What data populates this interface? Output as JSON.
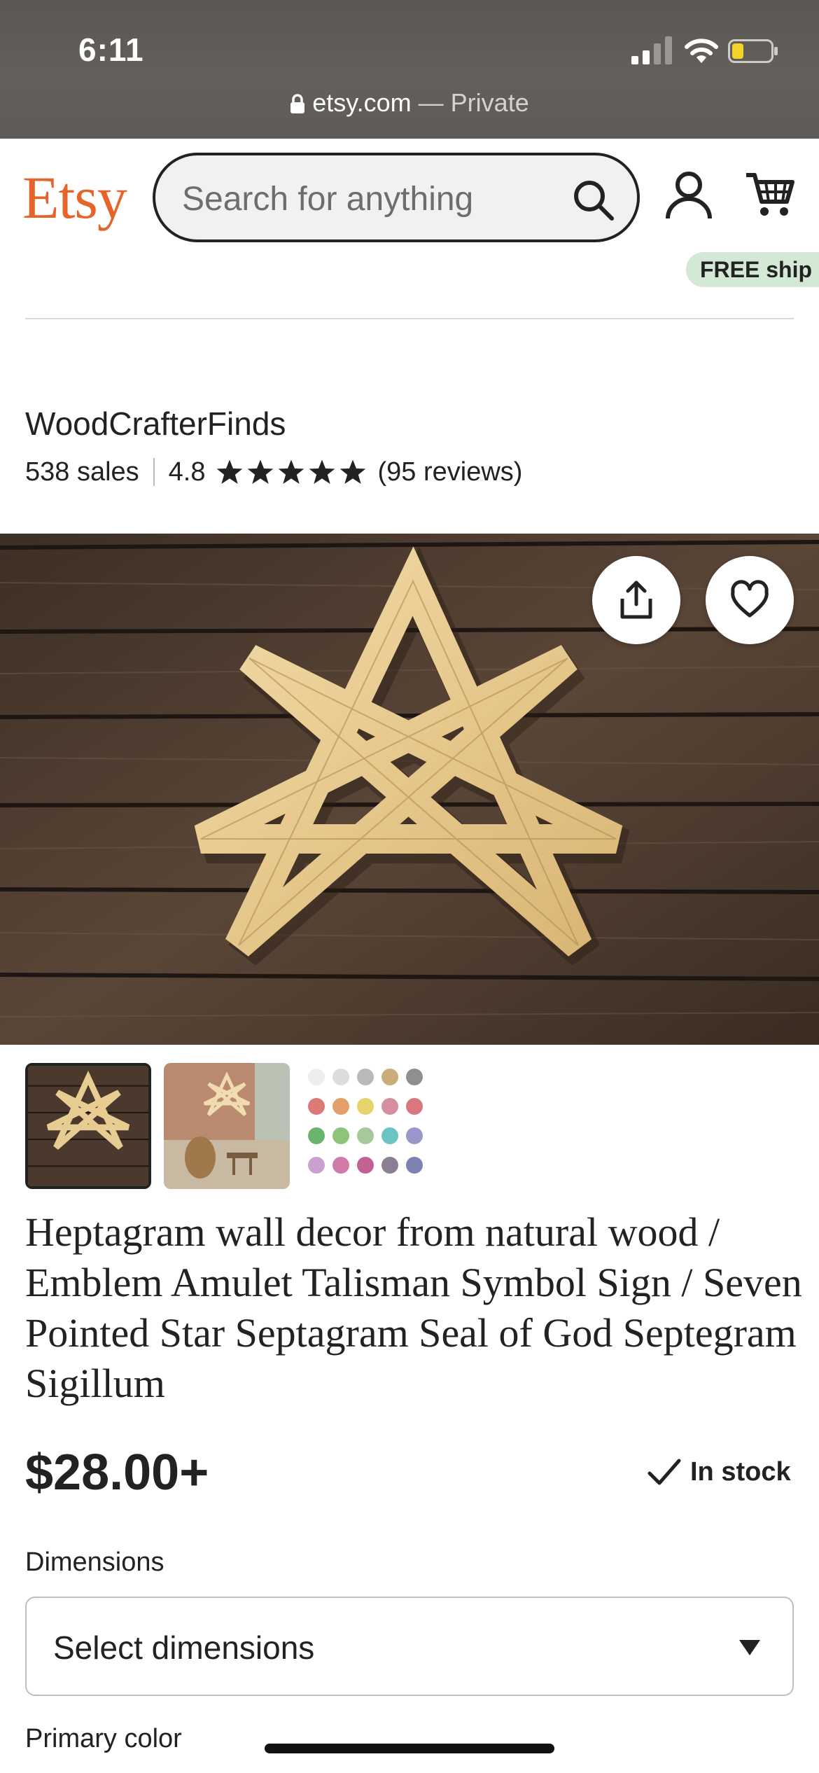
{
  "status_bar": {
    "time": "6:11"
  },
  "url_bar": {
    "domain": "etsy.com",
    "separator": " — ",
    "mode": "Private"
  },
  "header": {
    "logo": "Etsy",
    "search_placeholder": "Search for anything",
    "brand_color": "#e5642a"
  },
  "badge": {
    "free_shipping": "FREE ship"
  },
  "shop": {
    "name": "WoodCrafterFinds",
    "sales": "538 sales",
    "rating": "4.8",
    "stars": 5,
    "reviews": "(95 reviews)"
  },
  "gallery": {
    "thumbnails": [
      "heptagram-wood-thumb",
      "room-mockup-thumb",
      "color-swatches-thumb"
    ],
    "selected": 0
  },
  "listing": {
    "title": "Heptagram wall decor from natural wood / Emblem Amulet Talisman Symbol Sign / Seven Pointed Star Septagram Seal of God Septegram Sigillum",
    "price": "$28.00+",
    "stock": "In stock"
  },
  "options": {
    "dimensions_label": "Dimensions",
    "dimensions_value": "Select dimensions",
    "primary_color_label": "Primary color"
  }
}
